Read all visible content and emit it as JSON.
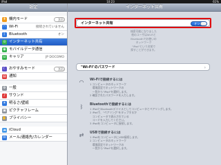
{
  "statusbar": {
    "left": "iPad",
    "time": "10:23",
    "battery": "61%"
  },
  "sidebar": {
    "title": "設定",
    "items": [
      {
        "label": "機内モード",
        "icon": "✈",
        "icon_color": "#f09a1a",
        "toggle": "オフ"
      },
      {
        "label": "Wi-Fi",
        "icon": "◠",
        "icon_color": "#2f78e0",
        "value": "接続されていません"
      },
      {
        "label": "Bluetooth",
        "icon": "ᛒ",
        "icon_color": "#2f78e0",
        "value": "オン"
      },
      {
        "label": "インターネット共有",
        "icon": "⊙",
        "icon_color": "#37b24d",
        "selected": true
      },
      {
        "label": "モバイルデータ通信",
        "icon": "◉",
        "icon_color": "#37b24d"
      },
      {
        "label": "キャリア",
        "icon": "☏",
        "icon_color": "#37b24d",
        "value": "JP DOCOMO"
      },
      {
        "label": "おやすみモード",
        "icon": "☾",
        "icon_color": "#5b4fc7",
        "toggle": "オフ"
      },
      {
        "label": "通知",
        "icon": "▤",
        "icon_color": "#e03b3b"
      },
      {
        "label": "一般",
        "icon": "⚙",
        "icon_color": "#8e949c"
      },
      {
        "label": "サウンド",
        "icon": "♪",
        "icon_color": "#e03b3b"
      },
      {
        "label": "明るさ/壁紙",
        "icon": "☀",
        "icon_color": "#2f78e0"
      },
      {
        "label": "ピクチャフレーム",
        "icon": "▣",
        "icon_color": "#8e949c"
      },
      {
        "label": "プライバシー",
        "icon": "✋",
        "icon_color": "#8e949c"
      },
      {
        "label": "iCloud",
        "icon": "☁",
        "icon_color": "#4a9be8"
      },
      {
        "label": "メール/連絡先/カレンダー",
        "icon": "✉",
        "icon_color": "#2f78e0"
      }
    ]
  },
  "main": {
    "title": "インターネット共有",
    "hotspot": {
      "label": "インターネット共有",
      "toggle": "オン"
    },
    "hotspot_desc": [
      "検索可能になりました",
      "他のユーザはWi-Fiと",
      "Bluetoothでお使いの",
      "ネットワーク",
      "\"iPad\"という名前で",
      "探すことができます。"
    ],
    "password": {
      "label": "\"Wi-Fi\"のパスワード"
    },
    "sections": [
      {
        "title": "Wi-Fiで接続するには",
        "icon": "◠",
        "lines": [
          "1 コンピュータのネットワーク",
          "　環境設定でネットワークの",
          "　一覧から\"iPad\"を選択します。",
          "2 確認されたパスワードを入力します。"
        ]
      },
      {
        "title": "Bluetoothで接続するには",
        "icon": "ᛒ",
        "lines": [
          "1 iPadとBluetoothデバイスとしてコンピュータとペアリングします。",
          "2 iPadで、\"ペアリング\"をタップするか",
          "　コンピュータで表示されている",
          "　コードを入力してください。",
          "3 iPadをコンピュータに接続します。"
        ]
      },
      {
        "title": "USBで接続するには",
        "icon": "⇄",
        "lines": [
          "1 iPadをコンピュータにUSB接続します。",
          "2 コンピュータのネットワーク",
          "　環境設定でネットワークの",
          "　一覧から\"iPad\"を選択します。"
        ]
      }
    ]
  }
}
